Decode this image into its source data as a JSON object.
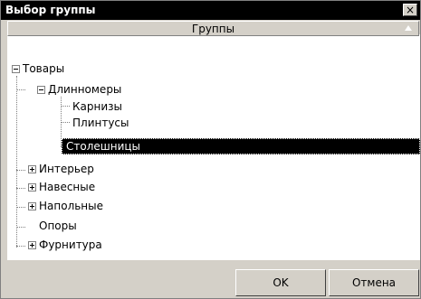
{
  "window": {
    "title": "Выбор группы",
    "close_glyph": "×"
  },
  "header": {
    "column": "Группы",
    "sort_icon": "sort-up-triangle"
  },
  "tree": [
    {
      "label": "Товары",
      "expander": "minus"
    },
    {
      "label": "Длинномеры",
      "expander": "minus"
    },
    {
      "label": "Карнизы"
    },
    {
      "label": "Плинтусы"
    },
    {
      "label": "Столешницы",
      "selected": true
    },
    {
      "label": "Интерьер",
      "expander": "plus"
    },
    {
      "label": "Навесные",
      "expander": "plus"
    },
    {
      "label": "Напольные",
      "expander": "plus"
    },
    {
      "label": "Опоры"
    },
    {
      "label": "Фурнитура",
      "expander": "plus"
    }
  ],
  "buttons": {
    "ok": "OK",
    "cancel": "Отмена"
  },
  "colors": {
    "selection": "#000000",
    "titlebar": "#000000",
    "face": "#d4d0c8"
  }
}
